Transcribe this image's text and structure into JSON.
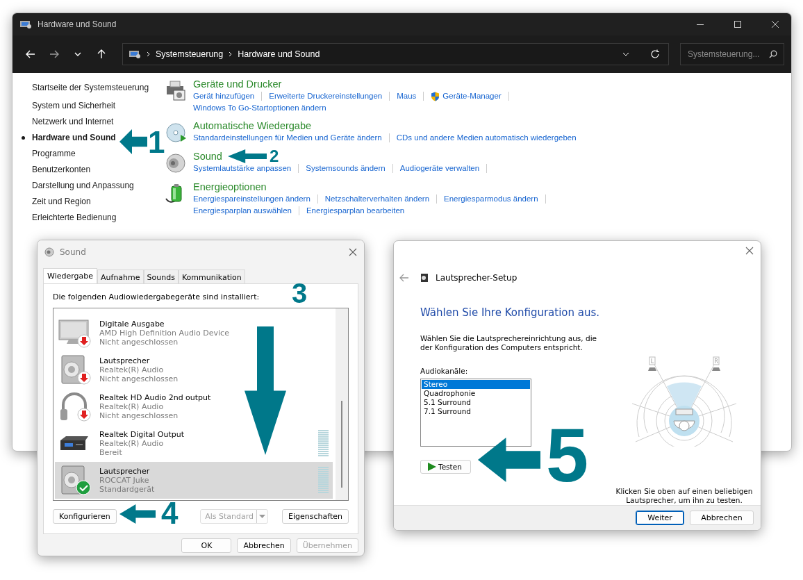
{
  "main_window": {
    "title": "Hardware und Sound",
    "breadcrumb": [
      "Systemsteuerung",
      "Hardware und Sound"
    ],
    "search": {
      "placeholder": "Systemsteuerung..."
    }
  },
  "sidebar": {
    "home": "Startseite der Systemsteuerung",
    "items": [
      {
        "label": "System und Sicherheit",
        "selected": false
      },
      {
        "label": "Netzwerk und Internet",
        "selected": false
      },
      {
        "label": "Hardware und Sound",
        "selected": true
      },
      {
        "label": "Programme",
        "selected": false
      },
      {
        "label": "Benutzerkonten",
        "selected": false
      },
      {
        "label": "Darstellung und Anpassung",
        "selected": false
      },
      {
        "label": "Zeit und Region",
        "selected": false
      },
      {
        "label": "Erleichterte Bedienung",
        "selected": false
      }
    ]
  },
  "categories": [
    {
      "title": "Geräte und Drucker",
      "kind": "printer",
      "rows": [
        [
          {
            "label": "Gerät hinzufügen",
            "kind": "plain"
          },
          {
            "label": "Erweiterte Druckereinstellungen",
            "kind": "plain"
          },
          {
            "label": "Maus",
            "kind": "plain"
          },
          {
            "label": "Geräte-Manager",
            "kind": "shield"
          }
        ],
        [
          {
            "label": "Windows To Go-Startoptionen ändern",
            "kind": "plain"
          }
        ]
      ]
    },
    {
      "title": "Automatische Wiedergabe",
      "kind": "autoplay",
      "rows": [
        [
          {
            "label": "Standardeinstellungen für Medien und Geräte ändern",
            "kind": "plain"
          },
          {
            "label": "CDs und andere Medien automatisch wiedergeben",
            "kind": "plain"
          }
        ]
      ]
    },
    {
      "title": "Sound",
      "kind": "speaker",
      "rows": [
        [
          {
            "label": "Systemlautstärke anpassen",
            "kind": "plain"
          },
          {
            "label": "Systemsounds ändern",
            "kind": "plain"
          },
          {
            "label": "Audiogeräte verwalten",
            "kind": "plain"
          }
        ]
      ]
    },
    {
      "title": "Energieoptionen",
      "kind": "battery",
      "rows": [
        [
          {
            "label": "Energiespareinstellungen ändern",
            "kind": "plain"
          },
          {
            "label": "Netzschalterverhalten ändern",
            "kind": "plain"
          },
          {
            "label": "Energiesparmodus ändern",
            "kind": "plain"
          }
        ],
        [
          {
            "label": "Energiesparplan auswählen",
            "kind": "plain"
          },
          {
            "label": "Energiesparplan bearbeiten",
            "kind": "plain"
          }
        ]
      ]
    }
  ],
  "sound_dialog": {
    "title": "Sound",
    "tabs": [
      {
        "label": "Wiedergabe",
        "selected": true
      },
      {
        "label": "Aufnahme",
        "selected": false
      },
      {
        "label": "Sounds",
        "selected": false
      },
      {
        "label": "Kommunikation",
        "selected": false
      }
    ],
    "intro": "Die folgenden Audiowiedergabegeräte sind installiert:",
    "devices": [
      {
        "name": "Digitale Ausgabe",
        "driver": "AMD High Definition Audio Device",
        "status": "Nicht angeschlossen",
        "kind": "monitor",
        "disconnected": true,
        "default_device": false,
        "meter": false,
        "selected": false
      },
      {
        "name": "Lautsprecher",
        "driver": "Realtek(R) Audio",
        "status": "Nicht angeschlossen",
        "kind": "speaker",
        "disconnected": true,
        "default_device": false,
        "meter": false,
        "selected": false
      },
      {
        "name": "Realtek HD Audio 2nd output",
        "driver": "Realtek(R) Audio",
        "status": "Nicht angeschlossen",
        "kind": "headphones",
        "disconnected": true,
        "default_device": false,
        "meter": false,
        "selected": false
      },
      {
        "name": "Realtek Digital Output",
        "driver": "Realtek(R) Audio",
        "status": "Bereit",
        "kind": "receiver",
        "disconnected": false,
        "default_device": false,
        "meter": true,
        "selected": false
      },
      {
        "name": "Lautsprecher",
        "driver": "ROCCAT Juke",
        "status": "Standardgerät",
        "kind": "speaker",
        "disconnected": false,
        "default_device": true,
        "meter": true,
        "selected": true
      }
    ],
    "actions": [
      {
        "label": "Konfigurieren",
        "disabled": false,
        "kind": "button"
      },
      {
        "label": "Als Standard",
        "disabled": true,
        "kind": "split"
      },
      {
        "label": "Eigenschaften",
        "disabled": false,
        "kind": "button"
      }
    ],
    "footer": [
      {
        "label": "OK",
        "disabled": false
      },
      {
        "label": "Abbrechen",
        "disabled": false
      },
      {
        "label": "Übernehmen",
        "disabled": true
      }
    ]
  },
  "speaker_setup": {
    "title": "Lautsprecher-Setup",
    "heading": "Wählen Sie Ihre Konfiguration aus.",
    "description": "Wählen Sie die Lautsprechereinrichtung aus, die der Konfiguration des Computers entspricht.",
    "channels_label": "Audiokanäle:",
    "channels": [
      {
        "label": "Stereo",
        "selected": true
      },
      {
        "label": "Quadrophonie",
        "selected": false
      },
      {
        "label": "5.1 Surround",
        "selected": false
      },
      {
        "label": "7.1 Surround",
        "selected": false
      }
    ],
    "test_button": "Testen",
    "speaker_labels": [
      "L",
      "R"
    ],
    "hint": "Klicken Sie oben auf einen beliebigen Lautsprecher, um ihn zu testen.",
    "footer": [
      {
        "label": "Weiter",
        "default": true
      },
      {
        "label": "Abbrechen",
        "default": false
      }
    ]
  },
  "annotations": [
    {
      "number": "1",
      "kind": "left"
    },
    {
      "number": "2",
      "kind": "left"
    },
    {
      "number": "3",
      "kind": "down"
    },
    {
      "number": "4",
      "kind": "left"
    },
    {
      "number": "5",
      "kind": "left"
    }
  ]
}
